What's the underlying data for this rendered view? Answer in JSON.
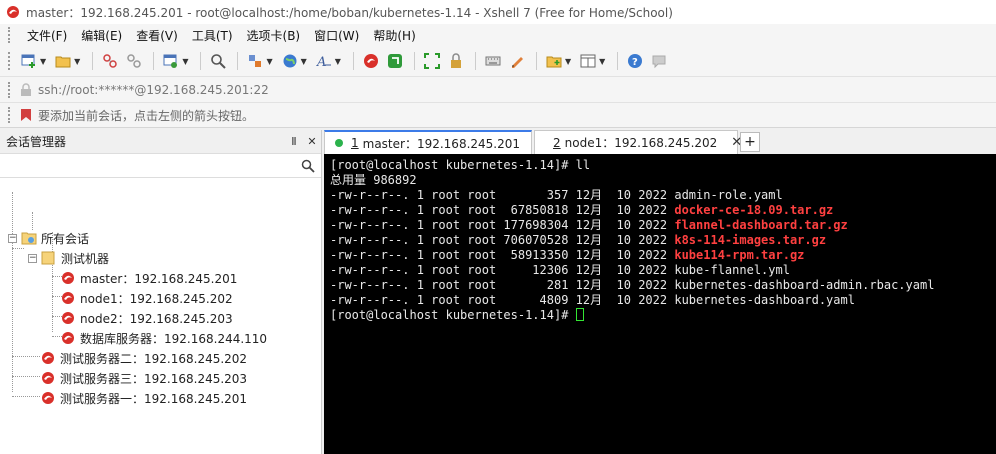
{
  "window": {
    "title": "master：192.168.245.201 - root@localhost:/home/boban/kubernetes-1.14 - Xshell 7 (Free for Home/School)"
  },
  "menu": [
    {
      "label": "文件(F)"
    },
    {
      "label": "编辑(E)"
    },
    {
      "label": "查看(V)"
    },
    {
      "label": "工具(T)"
    },
    {
      "label": "选项卡(B)"
    },
    {
      "label": "窗口(W)"
    },
    {
      "label": "帮助(H)"
    }
  ],
  "address": {
    "value": "ssh://root:******@192.168.245.201:22"
  },
  "hint": {
    "text": "要添加当前会话，点击左侧的箭头按钮。"
  },
  "session_panel": {
    "title": "会话管理器",
    "pin_label": "Ⅱ",
    "close_label": "✕",
    "tree": {
      "root": "所有会话",
      "group": "测试机器",
      "group_items": [
        {
          "label": "master：192.168.245.201"
        },
        {
          "label": "node1：192.168.245.202"
        },
        {
          "label": "node2：192.168.245.203"
        },
        {
          "label": "数据库服务器：192.168.244.110"
        }
      ],
      "servers": [
        {
          "label": "测试服务器二：192.168.245.202"
        },
        {
          "label": "测试服务器三：192.168.245.203"
        },
        {
          "label": "测试服务器一：192.168.245.201"
        }
      ]
    }
  },
  "tabs": [
    {
      "num": "1",
      "label": "master：192.168.245.201",
      "active": true
    },
    {
      "num": "2",
      "label": "node1：192.168.245.202",
      "active": false
    }
  ],
  "terminal": {
    "prompt1": "[root@localhost kubernetes-1.14]# ll",
    "total": "总用量 986892",
    "files": [
      {
        "meta": "-rw-r--r--. 1 root root       357 12月  10 2022 ",
        "name": "admin-role.yaml",
        "highlight": false
      },
      {
        "meta": "-rw-r--r--. 1 root root  67850818 12月  10 2022 ",
        "name": "docker-ce-18.09.tar.gz",
        "highlight": true
      },
      {
        "meta": "-rw-r--r--. 1 root root 177698304 12月  10 2022 ",
        "name": "flannel-dashboard.tar.gz",
        "highlight": true
      },
      {
        "meta": "-rw-r--r--. 1 root root 706070528 12月  10 2022 ",
        "name": "k8s-114-images.tar.gz",
        "highlight": true
      },
      {
        "meta": "-rw-r--r--. 1 root root  58913350 12月  10 2022 ",
        "name": "kube114-rpm.tar.gz",
        "highlight": true
      },
      {
        "meta": "-rw-r--r--. 1 root root     12306 12月  10 2022 ",
        "name": "kube-flannel.yml",
        "highlight": false
      },
      {
        "meta": "-rw-r--r--. 1 root root       281 12月  10 2022 ",
        "name": "kubernetes-dashboard-admin.rbac.yaml",
        "highlight": false
      },
      {
        "meta": "-rw-r--r--. 1 root root      4809 12月  10 2022 ",
        "name": "kubernetes-dashboard.yaml",
        "highlight": false
      }
    ],
    "prompt2": "[root@localhost kubernetes-1.14]# "
  },
  "colors": {
    "highlight_file": "#ff4040",
    "cursor": "#33e633",
    "tab_active_accent": "#3c7be8",
    "session_dot": "#2bb24c"
  }
}
